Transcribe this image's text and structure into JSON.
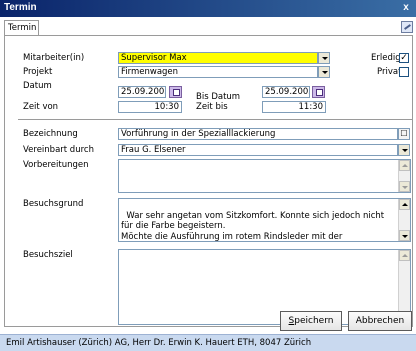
{
  "window": {
    "title": "Termin"
  },
  "tabs": [
    {
      "label": "Termin"
    }
  ],
  "icons": {
    "close": "close-icon",
    "edit": "edit-icon",
    "calendar": "calendar-icon",
    "lookup": "lookup-icon"
  },
  "form": {
    "mitarbeiter": {
      "label": "Mitarbeiter(in)",
      "value": "Supervisor Max"
    },
    "erledigt": {
      "label": "Erledigt",
      "checked": true,
      "mark": "✓"
    },
    "projekt": {
      "label": "Projekt",
      "value": "Firmenwagen"
    },
    "privat": {
      "label": "Privat",
      "checked": false
    },
    "datum": {
      "label": "Datum",
      "value": "25.09.2003"
    },
    "bis_datum": {
      "label": "Bis Datum",
      "value": "25.09.2003"
    },
    "zeit_von": {
      "label": "Zeit von",
      "value": "10:30"
    },
    "zeit_bis": {
      "label": "Zeit bis",
      "value": "11:30"
    },
    "bezeichnung": {
      "label": "Bezeichnung",
      "value": "Vorführung in der Spezialllackierung"
    },
    "vereinbart": {
      "label": "Vereinbart durch",
      "value": "Frau G. Elsener"
    },
    "vorbereitungen": {
      "label": "Vorbereitungen",
      "value": ""
    },
    "besuchsgrund": {
      "label": "Besuchsgrund",
      "value": "War sehr angetan vom Sitzkomfort. Konnte sich jedoch nicht für die Farbe begeistern.\nMöchte die Ausführung im rotem Rindsleder mit der eingebauten Minibar im Font."
    },
    "besuchsziel": {
      "label": "Besuchsziel",
      "value": ""
    }
  },
  "buttons": {
    "save": "Speichern",
    "save_mnemonic": "S",
    "save_rest": "peichern",
    "cancel": "Abbrechen"
  },
  "status": {
    "text": "Emil Artishauser (Zürich) AG, Herr Dr. Erwin K. Hauert ETH, 8047 Zürich"
  },
  "colors": {
    "titlebar": "#0a246a",
    "highlight": "#ffff00",
    "statusbar": "#c9d9ef"
  }
}
